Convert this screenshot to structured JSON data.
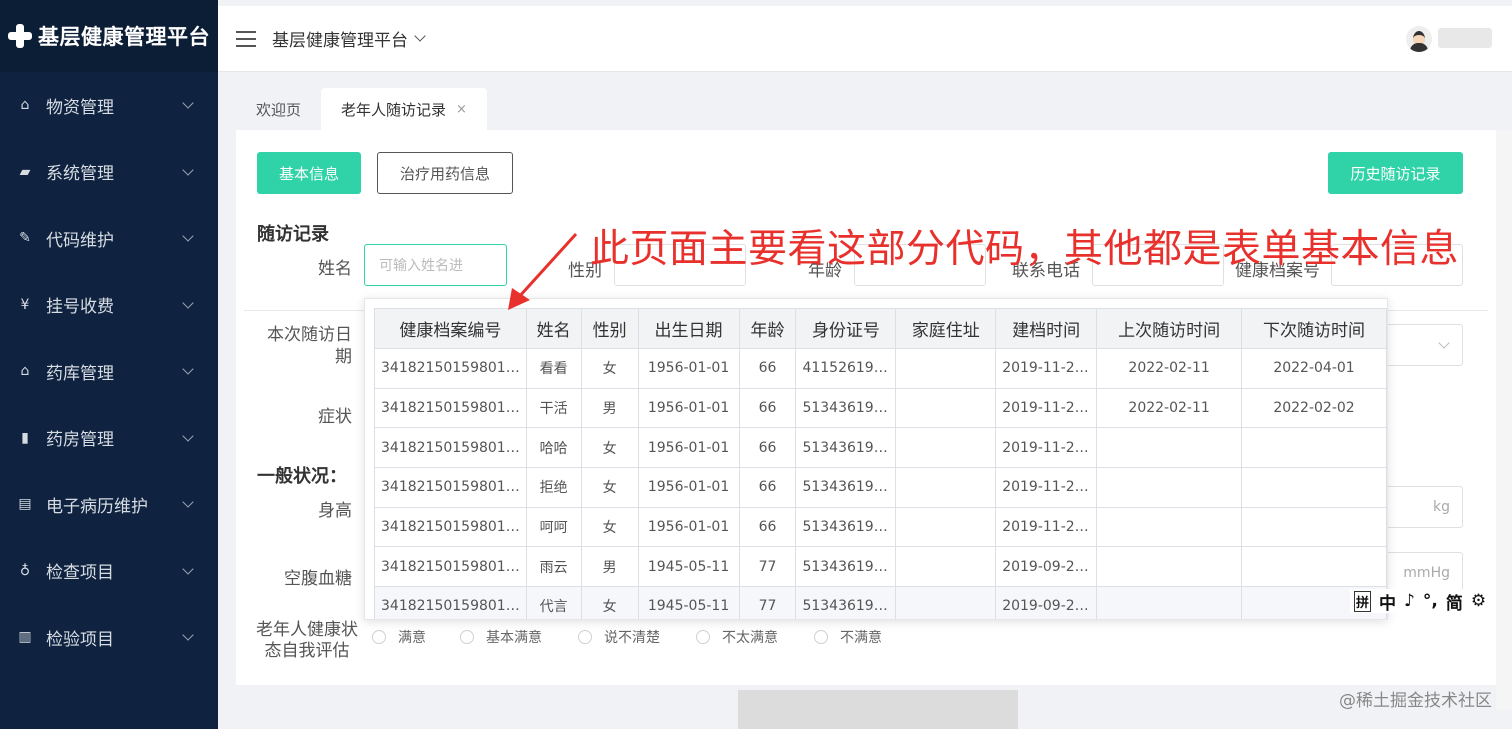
{
  "app": {
    "logo_text": "基层健康管理平台"
  },
  "sidebar": {
    "items": [
      {
        "label": "物资管理",
        "icon": "home-icon",
        "glyph": "⌂"
      },
      {
        "label": "系统管理",
        "icon": "briefcase-icon",
        "glyph": "▰"
      },
      {
        "label": "代码维护",
        "icon": "wrench-icon",
        "glyph": "✎"
      },
      {
        "label": "挂号收费",
        "icon": "yen-icon",
        "glyph": "¥"
      },
      {
        "label": "药库管理",
        "icon": "bank-icon",
        "glyph": "⌂"
      },
      {
        "label": "药房管理",
        "icon": "bottle-icon",
        "glyph": "▮"
      },
      {
        "label": "电子病历维护",
        "icon": "document-icon",
        "glyph": "▤"
      },
      {
        "label": "检查项目",
        "icon": "stethoscope-icon",
        "glyph": "♁"
      },
      {
        "label": "检验项目",
        "icon": "report-icon",
        "glyph": "▥"
      }
    ]
  },
  "header": {
    "title": "基层健康管理平台"
  },
  "tabs": [
    {
      "label": "欢迎页",
      "active": false
    },
    {
      "label": "老年人随访记录",
      "active": true,
      "close": "×"
    }
  ],
  "buttons": {
    "basic_info": "基本信息",
    "treatment": "治疗用药信息",
    "history": "历史随访记录"
  },
  "form": {
    "section_title": "随访记录",
    "name_label": "姓名",
    "name_placeholder": "可输入姓名进",
    "gender_label": "性别",
    "age_label": "年龄",
    "phone_label": "联系电话",
    "record_no_label": "健康档案号",
    "visit_date_label": "本次随访日期",
    "symptom_label": "症状",
    "general_title": "一般状况：",
    "height_label": "身高",
    "glucose_label": "空腹血糖",
    "weight_unit": "kg",
    "bp_unit": "mmHg",
    "self_eval_label": "老年人健康状态自我评估",
    "self_eval_options": [
      "满意",
      "基本满意",
      "说不清楚",
      "不太满意",
      "不满意"
    ]
  },
  "table": {
    "columns": [
      "健康档案编号",
      "姓名",
      "性别",
      "出生日期",
      "年龄",
      "身份证号",
      "家庭住址",
      "建档时间",
      "上次随访时间",
      "下次随访时间"
    ],
    "rows": [
      [
        "34182150159801…",
        "看看",
        "女",
        "1956-01-01",
        "66",
        "41152619…",
        "",
        "2019-11-2…",
        "2022-02-11",
        "2022-04-01"
      ],
      [
        "34182150159801…",
        "干活",
        "男",
        "1956-01-01",
        "66",
        "51343619…",
        "",
        "2019-11-2…",
        "2022-02-11",
        "2022-02-02"
      ],
      [
        "34182150159801…",
        "哈哈",
        "女",
        "1956-01-01",
        "66",
        "51343619…",
        "",
        "2019-11-2…",
        "",
        ""
      ],
      [
        "34182150159801…",
        "拒绝",
        "女",
        "1956-01-01",
        "66",
        "51343619…",
        "",
        "2019-11-2…",
        "",
        ""
      ],
      [
        "34182150159801…",
        "呵呵",
        "女",
        "1956-01-01",
        "66",
        "51343619…",
        "",
        "2019-11-2…",
        "",
        ""
      ],
      [
        "34182150159801…",
        "雨云",
        "男",
        "1945-05-11",
        "77",
        "51343619…",
        "",
        "2019-09-2…",
        "",
        ""
      ],
      [
        "34182150159801…",
        "代言",
        "女",
        "1945-05-11",
        "77",
        "51343619…",
        "",
        "2019-09-2…",
        "",
        ""
      ]
    ]
  },
  "annotation": "此页面主要看这部分代码，其他都是表单基本信息",
  "ime": {
    "box": "拼",
    "items": [
      "中",
      "♪",
      "°,",
      "简",
      "⚙"
    ]
  },
  "watermark": "@稀土掘金技术社区",
  "colors": {
    "sidebar_bg": "#0f2340",
    "accent": "#2fd3a7",
    "annotation": "#e8302c"
  }
}
